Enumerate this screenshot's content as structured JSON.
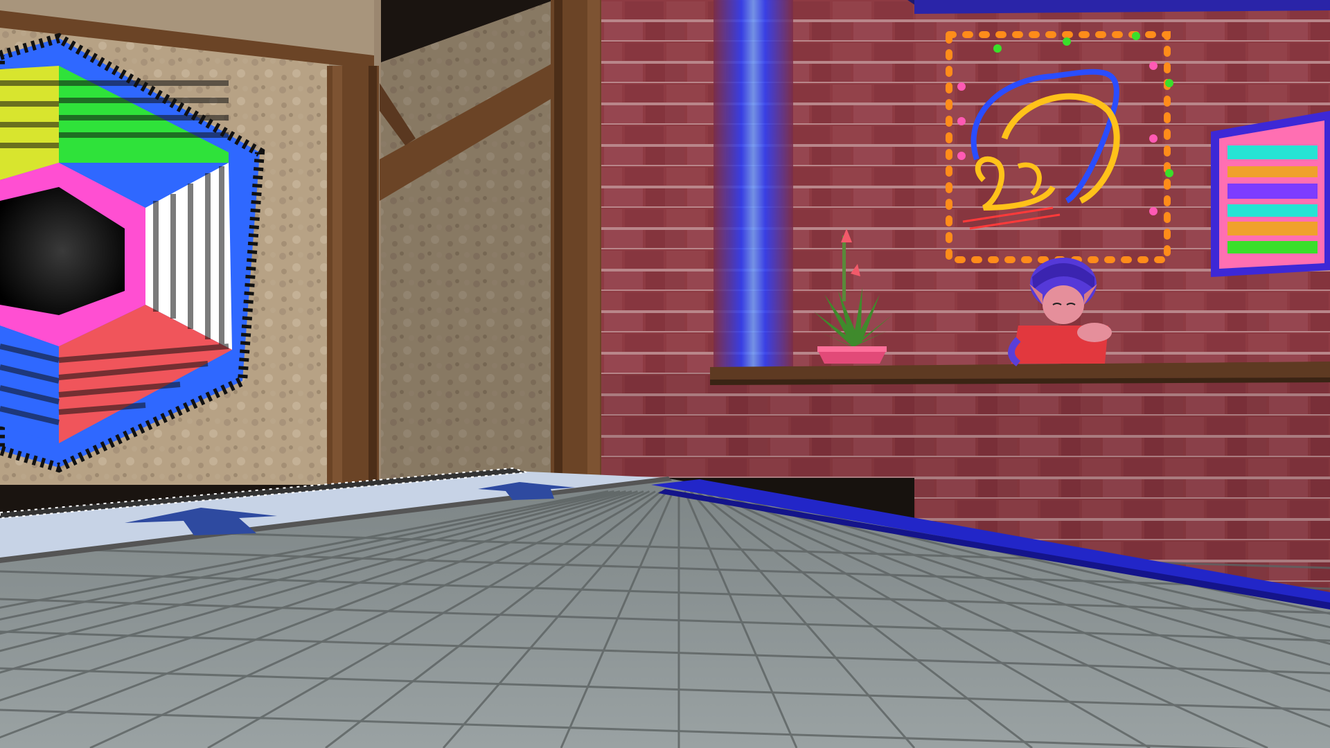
{
  "scene": {
    "palette": {
      "wall_tan": "#b8a387",
      "wall_tan_dark": "#8f7d66",
      "wood_beam": "#6b4426",
      "brick": "#8e3b43",
      "brick_dark": "#6d2a33",
      "floor_tile": "#8d9596",
      "floor_grout": "#5c6262",
      "carpet_light": "#c7d3e6",
      "carpet_arrow": "#2e4aa0",
      "blue_trim": "#2226c8",
      "neon_blue": "#2a5cff",
      "neon_yellow": "#ffc21a",
      "neon_frame": "#ff5ab4"
    },
    "hexagon_panel_colors": [
      "#d8e52e",
      "#2fe23a",
      "#ffffff",
      "#f0555b",
      "#2f68ff",
      "#ff4fd2"
    ],
    "arrow_count": 2
  }
}
